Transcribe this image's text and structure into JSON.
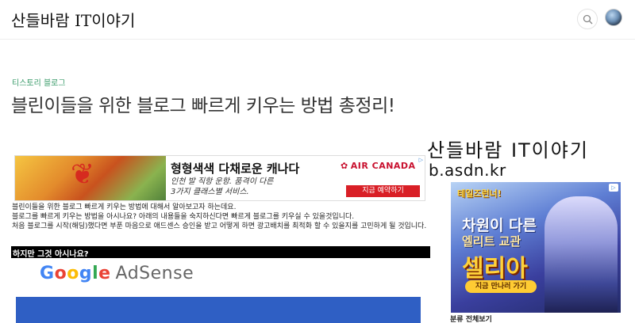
{
  "header": {
    "site_title": "산들바람 IT이야기"
  },
  "post": {
    "category": "티스토리 블로그",
    "title": "블린이들을 위한 블로그 빠르게 키우는 방법 총정리!"
  },
  "watermark": {
    "line1": "산들바람 IT이야기",
    "line2": "b.asdn.kr"
  },
  "ad_banner": {
    "headline": "형형색색 다채로운 캐나다",
    "sub1": "인천 발 직항 운항. 품격이 다른",
    "sub2": "3가지 클래스별 서비스.",
    "brand": "AIR CANADA",
    "cta": "지금 예약하기",
    "choice": "▷",
    "brand_color": "#c8102e"
  },
  "body": {
    "paragraphs": [
      "블린이들을 위한 블로그 빠르게 키우는 방법에 대해서 알아보고자 하는데요.",
      "블로그를 빠르게 키우는 방법을 아시나요? 아래의 내용들을 숙지하신다면 빠르게 블로그를 키우실 수 있을것입니다.",
      "처음 블로그를 시작(해딩)했다면 부푼 마음으로 애드센스 승인을 받고 어떻게 하면 광고배치를 최적화 할 수 있을지를 고민하게 될 것입니다."
    ],
    "highlight": "하지만 그것 아시나요?"
  },
  "adsense_image": {
    "google_letters": [
      "G",
      "o",
      "o",
      "g",
      "l",
      "e"
    ],
    "product": "AdSense"
  },
  "side_ad": {
    "logo": "테일즈런너!",
    "line1": "차원이 다른",
    "line2": "엘리트 교관",
    "line3": "셀리아",
    "button": "지금 만나러 가기",
    "choice": "▷"
  },
  "sidebar": {
    "heading": "분류 전체보기"
  },
  "icons": {
    "search": "search-icon",
    "avatar": "avatar"
  }
}
